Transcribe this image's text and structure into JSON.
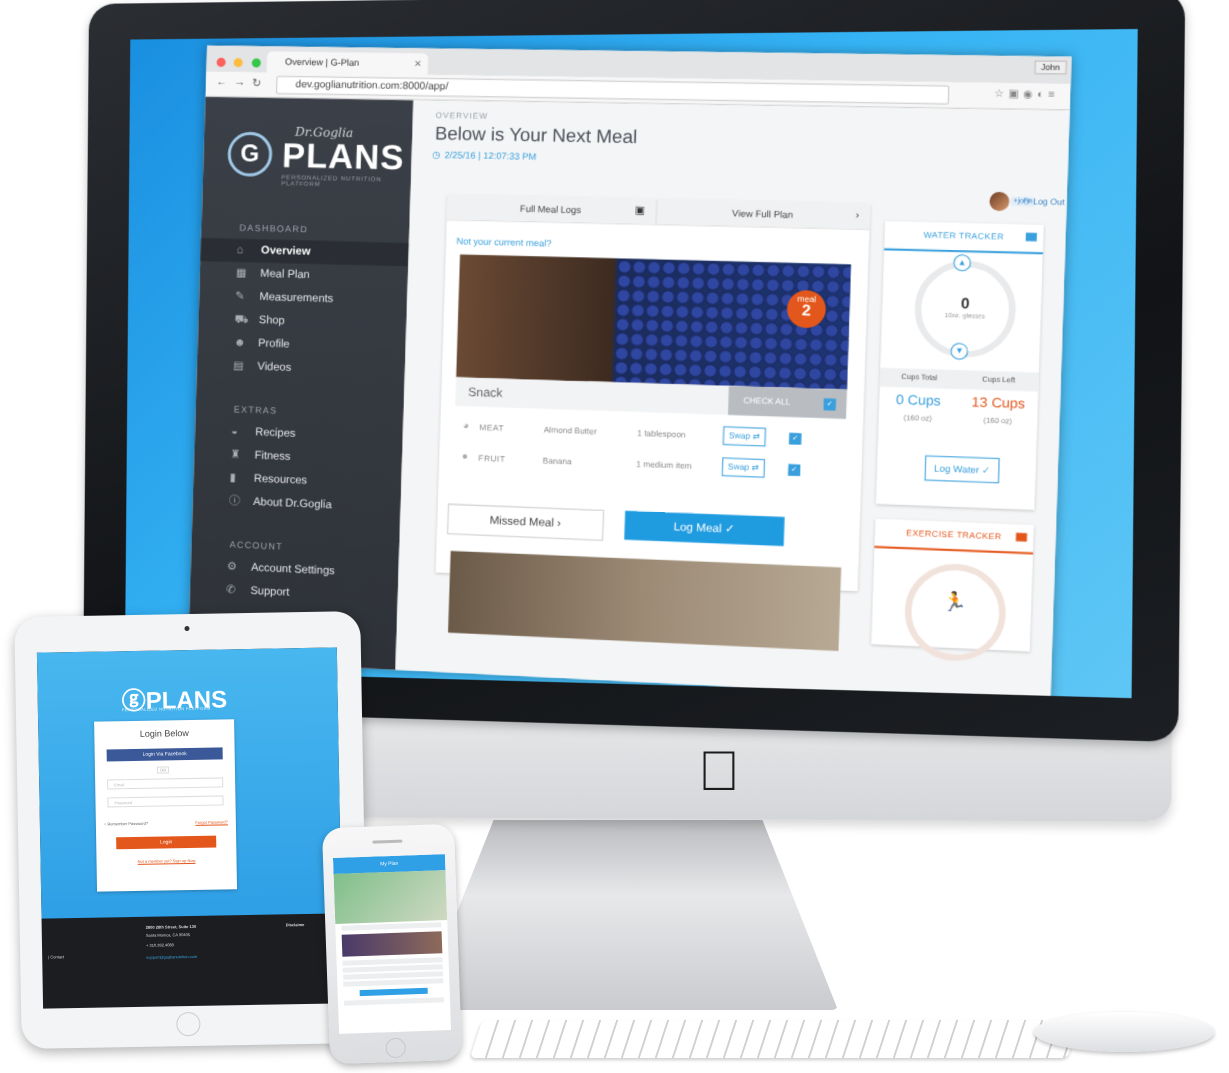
{
  "browser": {
    "tab_title": "Overview | G-Plan",
    "url": "dev.goglianutrition.com:8000/app/",
    "user_chip": "John"
  },
  "brand": {
    "script_name": "Dr.Goglia",
    "name": "PLANS",
    "tagline": "PERSONALIZED NUTRITION PLATFORM",
    "accent_color": "#1f9be0",
    "orange_color": "#e4571c"
  },
  "sidebar": {
    "section_dashboard": "DASHBOARD",
    "section_extras": "EXTRAS",
    "section_account": "ACCOUNT",
    "dashboard_items": [
      {
        "label": "Overview",
        "icon": "home-icon"
      },
      {
        "label": "Meal Plan",
        "icon": "calendar-icon"
      },
      {
        "label": "Measurements",
        "icon": "ruler-icon"
      },
      {
        "label": "Shop",
        "icon": "cart-icon"
      },
      {
        "label": "Profile",
        "icon": "user-icon"
      },
      {
        "label": "Videos",
        "icon": "film-icon"
      }
    ],
    "extras_items": [
      {
        "label": "Recipes",
        "icon": "bowl-icon"
      },
      {
        "label": "Fitness",
        "icon": "trophy-icon"
      },
      {
        "label": "Resources",
        "icon": "clipboard-icon"
      },
      {
        "label": "About Dr.Goglia",
        "icon": "info-icon"
      }
    ],
    "account_items": [
      {
        "label": "Account Settings",
        "icon": "gear-icon"
      },
      {
        "label": "Support",
        "icon": "wrench-icon"
      }
    ]
  },
  "main": {
    "overview_label": "OVERVIEW",
    "title": "Below is Your Next Meal",
    "timestamp": "2/25/16 | 12:07:33 PM",
    "user_badge": "+john",
    "logout": "Log Out",
    "tabs": [
      "Full Meal Logs",
      "View Full Plan"
    ],
    "not_current": "Not your current meal?",
    "meal_badge_label": "meal",
    "meal_badge_num": "2",
    "meal_name": "Snack",
    "check_all": "CHECK ALL",
    "foods": [
      {
        "category": "MEAT",
        "name": "Almond Butter",
        "qty": "1 tablespoon",
        "swap": "Swap"
      },
      {
        "category": "FRUIT",
        "name": "Banana",
        "qty": "1 medium item",
        "swap": "Swap"
      }
    ],
    "missed_meal": "Missed Meal",
    "log_meal": "Log Meal"
  },
  "water_tracker": {
    "title": "WATER TRACKER",
    "count": "0",
    "count_label": "10oz. glasses",
    "cups_total_label": "Cups Total",
    "cups_left_label": "Cups Left",
    "cups_total": "0 Cups",
    "cups_total_sub": "(160 oz)",
    "cups_left": "13 Cups",
    "cups_left_sub": "(160 oz)",
    "log_water": "Log Water"
  },
  "exercise_tracker": {
    "title": "EXERCISE TRACKER"
  },
  "tablet_login": {
    "brand": "PLANS",
    "brand_sub": "PERSONALIZED NUTRITION PLATFORM",
    "title": "Login Below",
    "facebook": "Login Via Facebook",
    "or": "OR",
    "email_placeholder": "Email",
    "password_placeholder": "Password",
    "remember": "Remember Password?",
    "forgot": "Forgot Password?",
    "login": "Login",
    "signup": "Not a member yet? Sign up Now",
    "address1": "2800 28th Street, Suite 130",
    "address2": "Santa Monica, CA 90405",
    "phone": "+ 310.392.4080",
    "email": "support@goglianutrition.com",
    "contact": "Contact",
    "disclaimer": "Disclaime"
  },
  "phone": {
    "header": "My Plan"
  }
}
